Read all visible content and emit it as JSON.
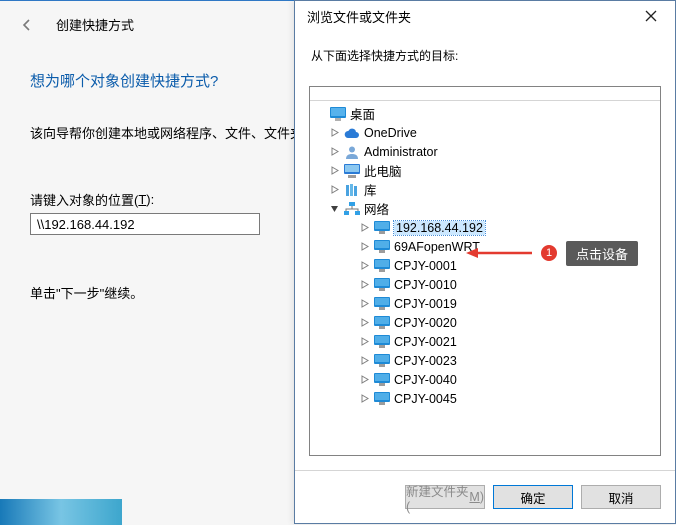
{
  "wizard": {
    "title": "创建快捷方式",
    "question": "想为哪个对象创建快捷方式?",
    "description": "该向导帮你创建本地或网络程序、文件、文件夹、",
    "location_label": "请键入对象的位置(",
    "location_accel": "T",
    "location_label_after": "):",
    "location_value": "\\\\192.168.44.192",
    "continue_text": "单击\"下一步\"继续。"
  },
  "dialog": {
    "title": "浏览文件或文件夹",
    "hint": "从下面选择快捷方式的目标:",
    "new_folder_label": "新建文件夹(",
    "new_folder_accel": "M",
    "new_folder_after": ")",
    "ok_label": "确定",
    "cancel_label": "取消"
  },
  "tree": {
    "root": "桌面",
    "items_lvl1": [
      {
        "icon": "cloud",
        "label": "OneDrive",
        "toggle": "right"
      },
      {
        "icon": "user",
        "label": "Administrator",
        "toggle": "right"
      },
      {
        "icon": "pc",
        "label": "此电脑",
        "toggle": "right"
      },
      {
        "icon": "library",
        "label": "库",
        "toggle": "right"
      },
      {
        "icon": "network",
        "label": "网络",
        "toggle": "down"
      }
    ],
    "network_children": [
      {
        "label": "192.168.44.192",
        "toggle": "right",
        "selected": true
      },
      {
        "label": "69AFopenWRT",
        "toggle": "right"
      },
      {
        "label": "CPJY-0001",
        "toggle": "right"
      },
      {
        "label": "CPJY-0010",
        "toggle": "right"
      },
      {
        "label": "CPJY-0019",
        "toggle": "right"
      },
      {
        "label": "CPJY-0020",
        "toggle": "right"
      },
      {
        "label": "CPJY-0021",
        "toggle": "right"
      },
      {
        "label": "CPJY-0023",
        "toggle": "right"
      },
      {
        "label": "CPJY-0040",
        "toggle": "right"
      },
      {
        "label": "CPJY-0045",
        "toggle": "right"
      }
    ]
  },
  "annotation": {
    "badge": "1",
    "tip": "点击设备"
  }
}
